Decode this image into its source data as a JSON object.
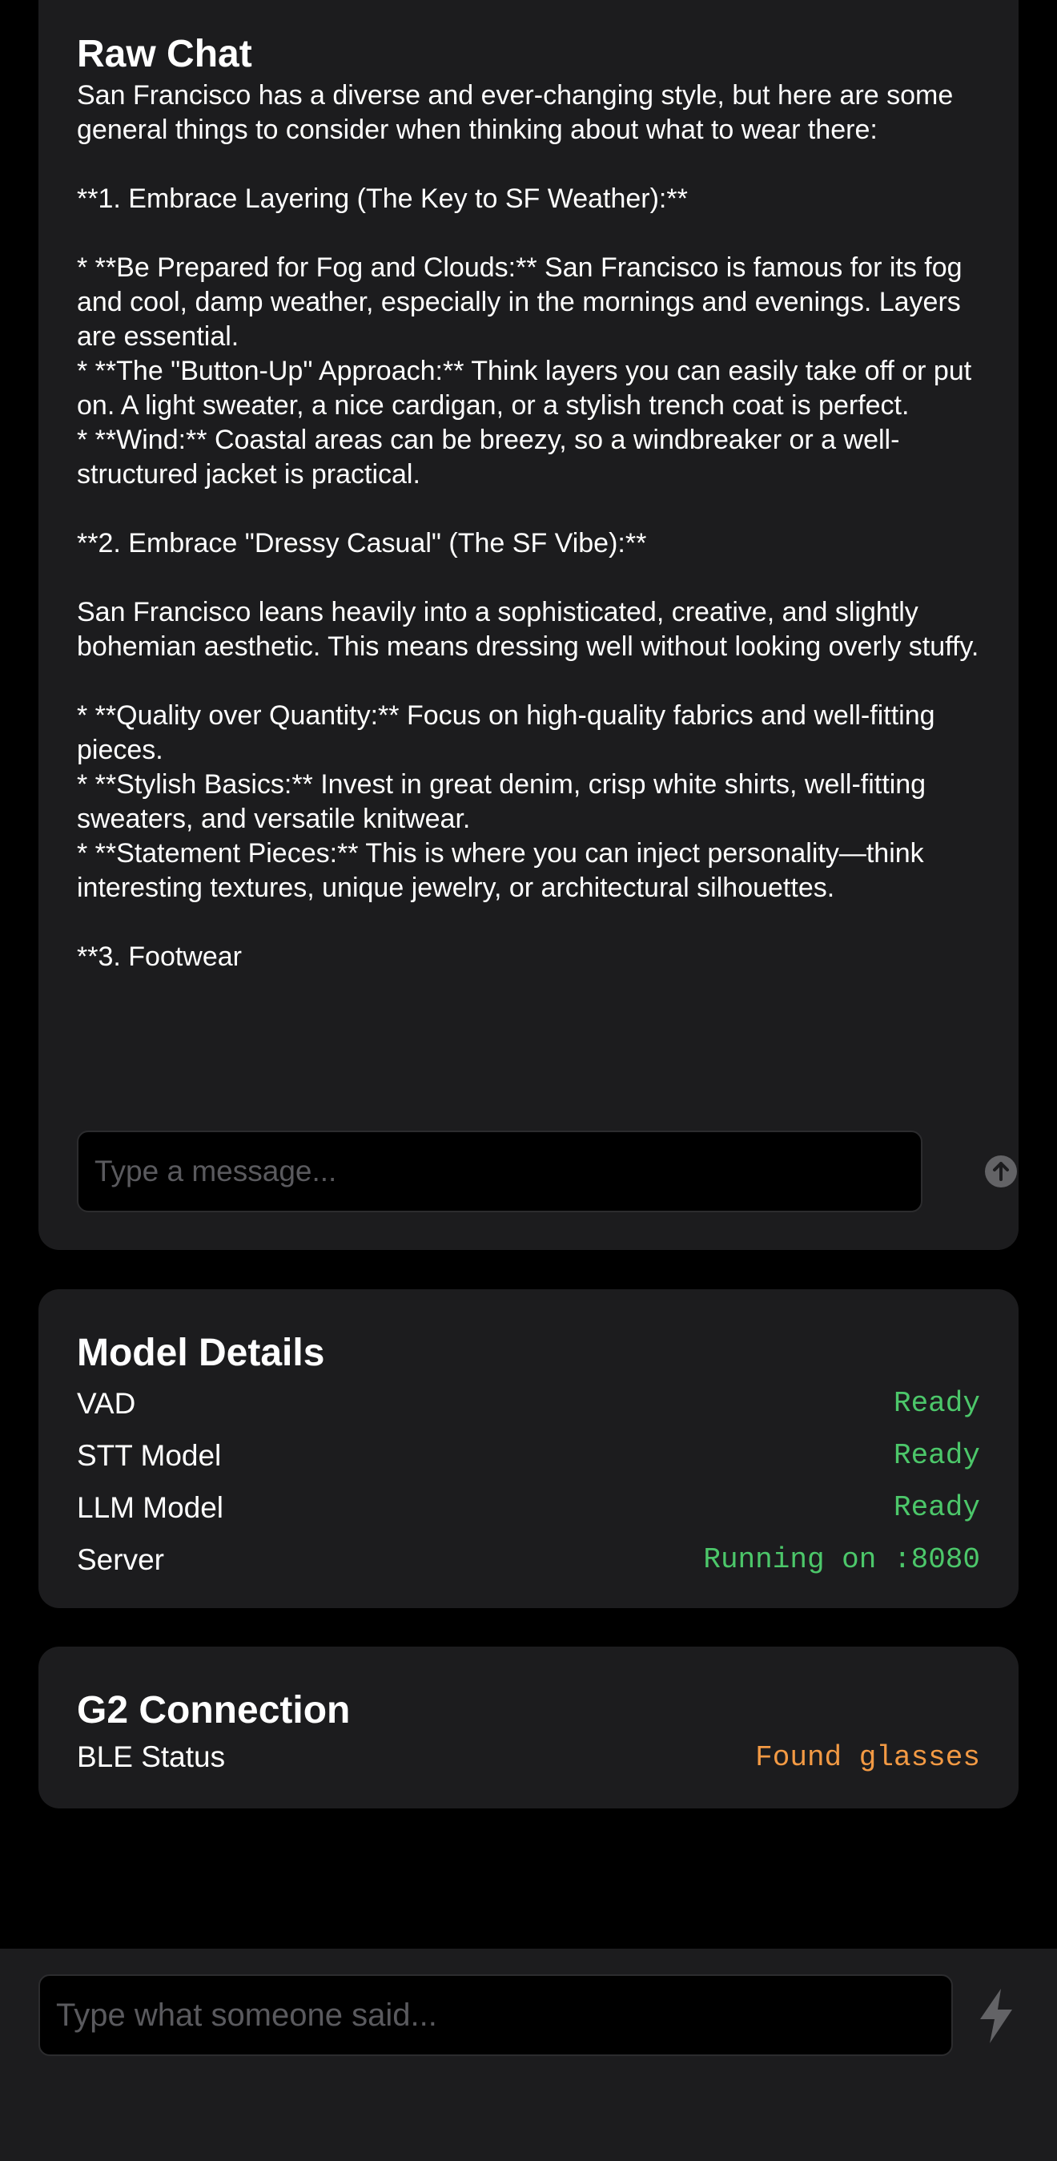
{
  "raw_chat": {
    "title": "Raw Chat",
    "message": "San Francisco has a diverse and ever-changing style, but here are some general things to consider when thinking about what to wear there:\n\n**1. Embrace Layering (The Key to SF Weather):**\n\n* **Be Prepared for Fog and Clouds:** San Francisco is famous for its fog and cool, damp weather, especially in the mornings and evenings. Layers are essential.\n* **The \"Button-Up\" Approach:** Think layers you can easily take off or put on. A light sweater, a nice cardigan, or a stylish trench coat is perfect.\n* **Wind:** Coastal areas can be breezy, so a windbreaker or a well-structured jacket is practical.\n\n**2. Embrace \"Dressy Casual\" (The SF Vibe):**\n\nSan Francisco leans heavily into a sophisticated, creative, and slightly bohemian aesthetic. This means dressing well without looking overly stuffy.\n\n* **Quality over Quantity:** Focus on high-quality fabrics and well-fitting pieces.\n* **Stylish Basics:** Invest in great denim, crisp white shirts, well-fitting sweaters, and versatile knitwear.\n* **Statement Pieces:** This is where you can inject personality—think interesting textures, unique jewelry, or architectural silhouettes.\n\n**3. Footwear",
    "input_placeholder": "Type a message...",
    "input_value": "",
    "send_icon": "arrow-up-circle-icon"
  },
  "model_details": {
    "title": "Model Details",
    "rows": [
      {
        "label": "VAD",
        "value": "Ready"
      },
      {
        "label": "STT Model",
        "value": "Ready"
      },
      {
        "label": "LLM Model",
        "value": "Ready"
      },
      {
        "label": "Server",
        "value": "Running on :8080"
      }
    ],
    "status_color": "#4cc76a"
  },
  "g2_connection": {
    "title": "G2 Connection",
    "rows": [
      {
        "label": "BLE Status",
        "value": "Found glasses"
      }
    ],
    "status_color": "#f39a44"
  },
  "bottom_bar": {
    "input_placeholder": "Type what someone said...",
    "input_value": "",
    "action_icon": "lightning-bolt-icon"
  }
}
